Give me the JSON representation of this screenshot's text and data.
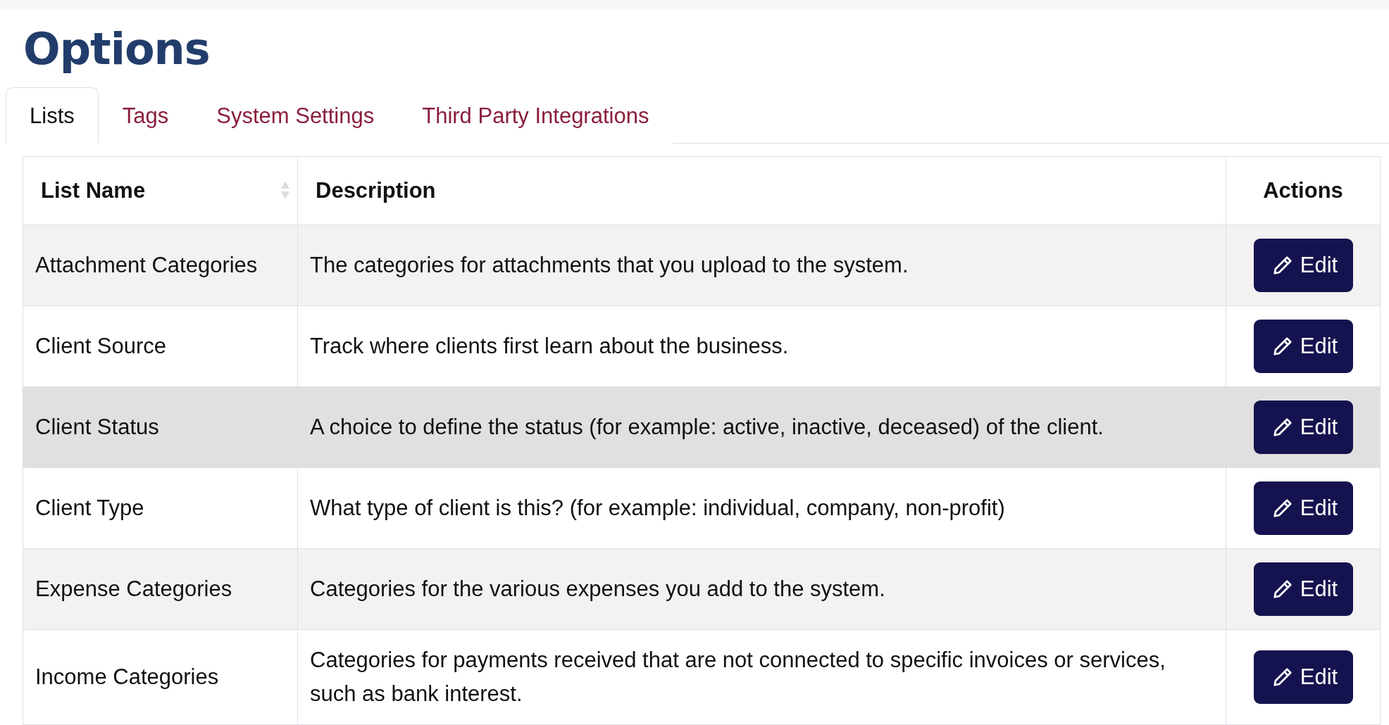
{
  "title": "Options",
  "tabs": [
    {
      "label": "Lists",
      "selected": true
    },
    {
      "label": "Tags",
      "selected": false
    },
    {
      "label": "System Settings",
      "selected": false
    },
    {
      "label": "Third Party Integrations",
      "selected": false
    }
  ],
  "table": {
    "columns": [
      "List Name",
      "Description",
      "Actions"
    ],
    "rows": [
      {
        "name": "Attachment Categories",
        "description": "The categories for attachments that you upload to the system.",
        "action": "Edit",
        "hovered": false
      },
      {
        "name": "Client Source",
        "description": "Track where clients first learn about the business.",
        "action": "Edit",
        "hovered": false
      },
      {
        "name": "Client Status",
        "description": "A choice to define the status (for example: active, inactive, deceased) of the client.",
        "action": "Edit",
        "hovered": true
      },
      {
        "name": "Client Type",
        "description": "What type of client is this? (for example: individual, company, non-profit)",
        "action": "Edit",
        "hovered": false
      },
      {
        "name": "Expense Categories",
        "description": "Categories for the various expenses you add to the system.",
        "action": "Edit",
        "hovered": false
      },
      {
        "name": "Income Categories",
        "description": "Categories for payments received that are not connected to specific invoices or services, such as bank interest.",
        "action": "Edit",
        "hovered": false
      }
    ]
  }
}
